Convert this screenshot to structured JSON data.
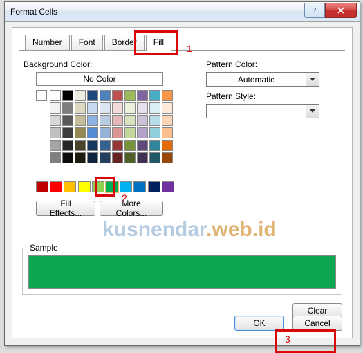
{
  "window": {
    "title": "Format Cells"
  },
  "tabs": {
    "number": "Number",
    "font": "Font",
    "border": "Border",
    "fill": "Fill",
    "active": "fill"
  },
  "left": {
    "bg_label": "Background Color:",
    "no_color": "No Color",
    "fill_effects": "Fill Effects...",
    "more_colors": "More Colors..."
  },
  "right": {
    "pattern_color_label": "Pattern Color:",
    "pattern_color_value": "Automatic",
    "pattern_style_label": "Pattern Style:",
    "pattern_style_value": ""
  },
  "sample": {
    "label": "Sample",
    "color": "#0aa651"
  },
  "buttons": {
    "clear": "Clear",
    "ok": "OK",
    "cancel": "Cancel"
  },
  "annotations": {
    "a1": "1",
    "a2": "2",
    "a3": "3"
  },
  "watermark": {
    "part1": "kusnendar",
    "part2": ".web.id"
  },
  "palette1": [
    [
      "#ffffff",
      "#000000",
      "#eeece1",
      "#1f497d",
      "#4f81bd",
      "#c0504d",
      "#9bbb59",
      "#8064a2",
      "#4bacc6",
      "#f79646"
    ],
    [
      "#f2f2f2",
      "#7f7f7f",
      "#ddd9c3",
      "#c6d9f0",
      "#dbe5f1",
      "#f2dcdb",
      "#ebf1dd",
      "#e5e0ec",
      "#dbeef3",
      "#fdeada"
    ],
    [
      "#d8d8d8",
      "#595959",
      "#c4bd97",
      "#8db3e2",
      "#b8cce4",
      "#e5b9b7",
      "#d7e3bc",
      "#ccc1d9",
      "#b7dde8",
      "#fbd5b5"
    ],
    [
      "#bfbfbf",
      "#3f3f3f",
      "#938953",
      "#548dd4",
      "#95b3d7",
      "#d99694",
      "#c3d69b",
      "#b2a2c7",
      "#92cddc",
      "#fac08f"
    ],
    [
      "#a5a5a5",
      "#262626",
      "#494429",
      "#17365d",
      "#366092",
      "#953734",
      "#76923c",
      "#5f497a",
      "#31859b",
      "#e36c09"
    ],
    [
      "#7f7f7f",
      "#0c0c0c",
      "#1d1b10",
      "#0f243e",
      "#244061",
      "#632423",
      "#4f6128",
      "#3f3151",
      "#205867",
      "#974806"
    ]
  ],
  "palette2": [
    "#c00000",
    "#ff0000",
    "#ffc000",
    "#ffff00",
    "#92d050",
    "#00b050",
    "#00b0f0",
    "#0070c0",
    "#002060",
    "#7030a0"
  ],
  "selected_swatch": {
    "row": 0,
    "col": 5,
    "palette": 2,
    "color": "#00b050"
  }
}
